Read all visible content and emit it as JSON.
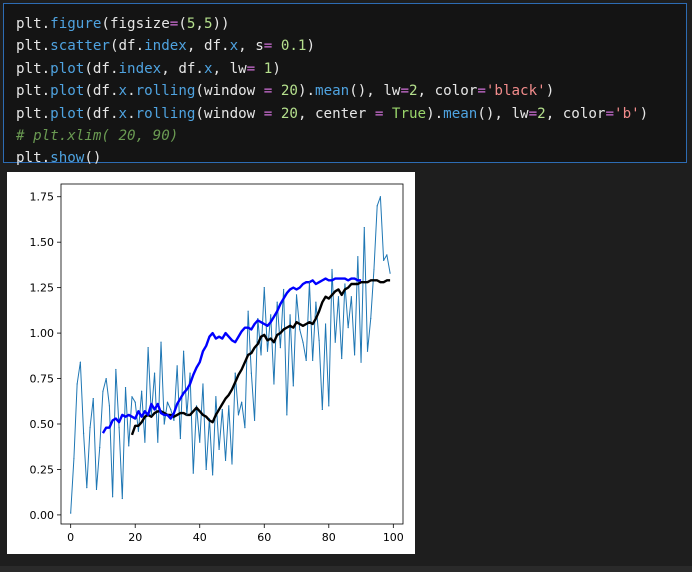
{
  "code_cell": {
    "lines": [
      [
        {
          "t": "plt.",
          "c": "txt"
        },
        {
          "t": "figure",
          "c": "fn"
        },
        {
          "t": "(figsize",
          "c": "txt"
        },
        {
          "t": "=",
          "c": "op"
        },
        {
          "t": "(",
          "c": "txt"
        },
        {
          "t": "5",
          "c": "num"
        },
        {
          "t": ",",
          "c": "txt"
        },
        {
          "t": "5",
          "c": "num"
        },
        {
          "t": "))",
          "c": "txt"
        }
      ],
      [
        {
          "t": "plt.",
          "c": "txt"
        },
        {
          "t": "scatter",
          "c": "fn"
        },
        {
          "t": "(df.",
          "c": "txt"
        },
        {
          "t": "index",
          "c": "fn"
        },
        {
          "t": ", df.",
          "c": "txt"
        },
        {
          "t": "x",
          "c": "fn"
        },
        {
          "t": ", s",
          "c": "txt"
        },
        {
          "t": "=",
          "c": "op"
        },
        {
          "t": " ",
          "c": "txt"
        },
        {
          "t": "0.1",
          "c": "num"
        },
        {
          "t": ")",
          "c": "txt"
        }
      ],
      [
        {
          "t": "plt.",
          "c": "txt"
        },
        {
          "t": "plot",
          "c": "fn"
        },
        {
          "t": "(df.",
          "c": "txt"
        },
        {
          "t": "index",
          "c": "fn"
        },
        {
          "t": ", df.",
          "c": "txt"
        },
        {
          "t": "x",
          "c": "fn"
        },
        {
          "t": ", lw",
          "c": "txt"
        },
        {
          "t": "=",
          "c": "op"
        },
        {
          "t": " ",
          "c": "txt"
        },
        {
          "t": "1",
          "c": "num"
        },
        {
          "t": ")",
          "c": "txt"
        }
      ],
      [
        {
          "t": "plt.",
          "c": "txt"
        },
        {
          "t": "plot",
          "c": "fn"
        },
        {
          "t": "(df.",
          "c": "txt"
        },
        {
          "t": "x",
          "c": "fn"
        },
        {
          "t": ".",
          "c": "txt"
        },
        {
          "t": "rolling",
          "c": "fn"
        },
        {
          "t": "(window ",
          "c": "txt"
        },
        {
          "t": "=",
          "c": "op"
        },
        {
          "t": " ",
          "c": "txt"
        },
        {
          "t": "20",
          "c": "num"
        },
        {
          "t": ").",
          "c": "txt"
        },
        {
          "t": "mean",
          "c": "fn"
        },
        {
          "t": "(), lw",
          "c": "txt"
        },
        {
          "t": "=",
          "c": "op"
        },
        {
          "t": "2",
          "c": "num"
        },
        {
          "t": ", color",
          "c": "txt"
        },
        {
          "t": "=",
          "c": "op"
        },
        {
          "t": "'black'",
          "c": "str"
        },
        {
          "t": ")",
          "c": "txt"
        }
      ],
      [
        {
          "t": "plt.",
          "c": "txt"
        },
        {
          "t": "plot",
          "c": "fn"
        },
        {
          "t": "(df.",
          "c": "txt"
        },
        {
          "t": "x",
          "c": "fn"
        },
        {
          "t": ".",
          "c": "txt"
        },
        {
          "t": "rolling",
          "c": "fn"
        },
        {
          "t": "(window ",
          "c": "txt"
        },
        {
          "t": "=",
          "c": "op"
        },
        {
          "t": " ",
          "c": "txt"
        },
        {
          "t": "20",
          "c": "num"
        },
        {
          "t": ", center ",
          "c": "txt"
        },
        {
          "t": "=",
          "c": "op"
        },
        {
          "t": " ",
          "c": "txt"
        },
        {
          "t": "True",
          "c": "kw"
        },
        {
          "t": ").",
          "c": "txt"
        },
        {
          "t": "mean",
          "c": "fn"
        },
        {
          "t": "(), lw",
          "c": "txt"
        },
        {
          "t": "=",
          "c": "op"
        },
        {
          "t": "2",
          "c": "num"
        },
        {
          "t": ", color",
          "c": "txt"
        },
        {
          "t": "=",
          "c": "op"
        },
        {
          "t": "'b'",
          "c": "str"
        },
        {
          "t": ")",
          "c": "txt"
        }
      ],
      [
        {
          "t": "# plt.xlim( 20, 90)",
          "c": "cm"
        }
      ],
      [
        {
          "t": "plt.",
          "c": "txt"
        },
        {
          "t": "show",
          "c": "fn"
        },
        {
          "t": "()",
          "c": "txt"
        }
      ]
    ]
  },
  "chart_data": {
    "type": "line",
    "title": "",
    "xlabel": "",
    "ylabel": "",
    "xlim": [
      -3,
      103
    ],
    "ylim": [
      -0.05,
      1.82
    ],
    "x_ticks": [
      0,
      20,
      40,
      60,
      80,
      100
    ],
    "y_ticks": [
      0.0,
      0.25,
      0.5,
      0.75,
      1.0,
      1.25,
      1.5,
      1.75
    ],
    "y_tick_labels": [
      "0.00",
      "0.25",
      "0.50",
      "0.75",
      "1.00",
      "1.25",
      "1.50",
      "1.75"
    ],
    "grid": false,
    "colors": {
      "raw": "#1f77b4",
      "rolling": "#000000",
      "rolling_centered": "#0000ff"
    },
    "series": [
      {
        "values": [
          0.01,
          0.31,
          0.72,
          0.84,
          0.45,
          0.15,
          0.48,
          0.64,
          0.14,
          0.37,
          0.68,
          0.75,
          0.6,
          0.1,
          0.8,
          0.48,
          0.09,
          0.7,
          0.38,
          0.65,
          0.62,
          0.46,
          0.68,
          0.4,
          0.92,
          0.55,
          0.78,
          0.4,
          0.95,
          0.5,
          0.62,
          0.58,
          0.52,
          0.82,
          0.42,
          0.9,
          0.55,
          0.78,
          0.23,
          0.6,
          0.4,
          0.72,
          0.25,
          0.53,
          0.22,
          0.65,
          0.36,
          0.58,
          0.3,
          0.6,
          0.28,
          0.78,
          0.55,
          0.62,
          0.48,
          1.12,
          0.78,
          0.52,
          1.08,
          0.88,
          1.25,
          0.9,
          1.1,
          0.72,
          1.17,
          0.92,
          1.24,
          0.55,
          1.1,
          0.71,
          1.21,
          1.02,
          0.95,
          0.85,
          1.28,
          0.85,
          1.17,
          0.96,
          0.58,
          1.05,
          0.6,
          1.35,
          0.95,
          1.2,
          0.86,
          1.27,
          1.03,
          1.2,
          0.88,
          1.42,
          0.84,
          1.58,
          0.9,
          1.08,
          1.35,
          1.7,
          1.75,
          1.4,
          1.43,
          1.33
        ]
      },
      {
        "start": 19,
        "values": [
          0.44,
          0.49,
          0.49,
          0.51,
          0.54,
          0.55,
          0.54,
          0.56,
          0.57,
          0.57,
          0.56,
          0.55,
          0.55,
          0.54,
          0.55,
          0.56,
          0.56,
          0.55,
          0.55,
          0.57,
          0.59,
          0.57,
          0.55,
          0.54,
          0.52,
          0.51,
          0.55,
          0.58,
          0.61,
          0.64,
          0.66,
          0.69,
          0.73,
          0.77,
          0.8,
          0.84,
          0.88,
          0.89,
          0.92,
          0.94,
          0.98,
          0.99,
          0.96,
          0.97,
          0.95,
          0.99,
          1.0,
          1.02,
          1.03,
          1.04,
          1.03,
          1.06,
          1.05,
          1.04,
          1.05,
          1.06,
          1.05,
          1.08,
          1.12,
          1.17,
          1.2,
          1.19,
          1.21,
          1.23,
          1.24,
          1.21,
          1.24,
          1.25,
          1.27,
          1.27,
          1.27,
          1.28,
          1.28,
          1.28,
          1.29,
          1.29,
          1.29,
          1.28,
          1.28,
          1.29,
          1.29
        ]
      },
      {
        "start": 10,
        "values": [
          0.45,
          0.48,
          0.48,
          0.52,
          0.53,
          0.51,
          0.55,
          0.54,
          0.55,
          0.54,
          0.53,
          0.57,
          0.54,
          0.57,
          0.55,
          0.61,
          0.58,
          0.61,
          0.56,
          0.55,
          0.55,
          0.53,
          0.56,
          0.61,
          0.64,
          0.67,
          0.69,
          0.72,
          0.77,
          0.81,
          0.84,
          0.9,
          0.93,
          0.98,
          1.0,
          0.97,
          0.98,
          0.97,
          1.0,
          0.98,
          0.96,
          0.95,
          0.98,
          1.01,
          1.03,
          1.03,
          1.02,
          1.05,
          1.07,
          1.06,
          1.05,
          1.04,
          1.06,
          1.09,
          1.12,
          1.16,
          1.19,
          1.22,
          1.24,
          1.25,
          1.24,
          1.25,
          1.27,
          1.28,
          1.28,
          1.29,
          1.27,
          1.28,
          1.29,
          1.3,
          1.29,
          1.29,
          1.3,
          1.3,
          1.3,
          1.3,
          1.29,
          1.3,
          1.3,
          1.29,
          1.29
        ]
      }
    ]
  }
}
